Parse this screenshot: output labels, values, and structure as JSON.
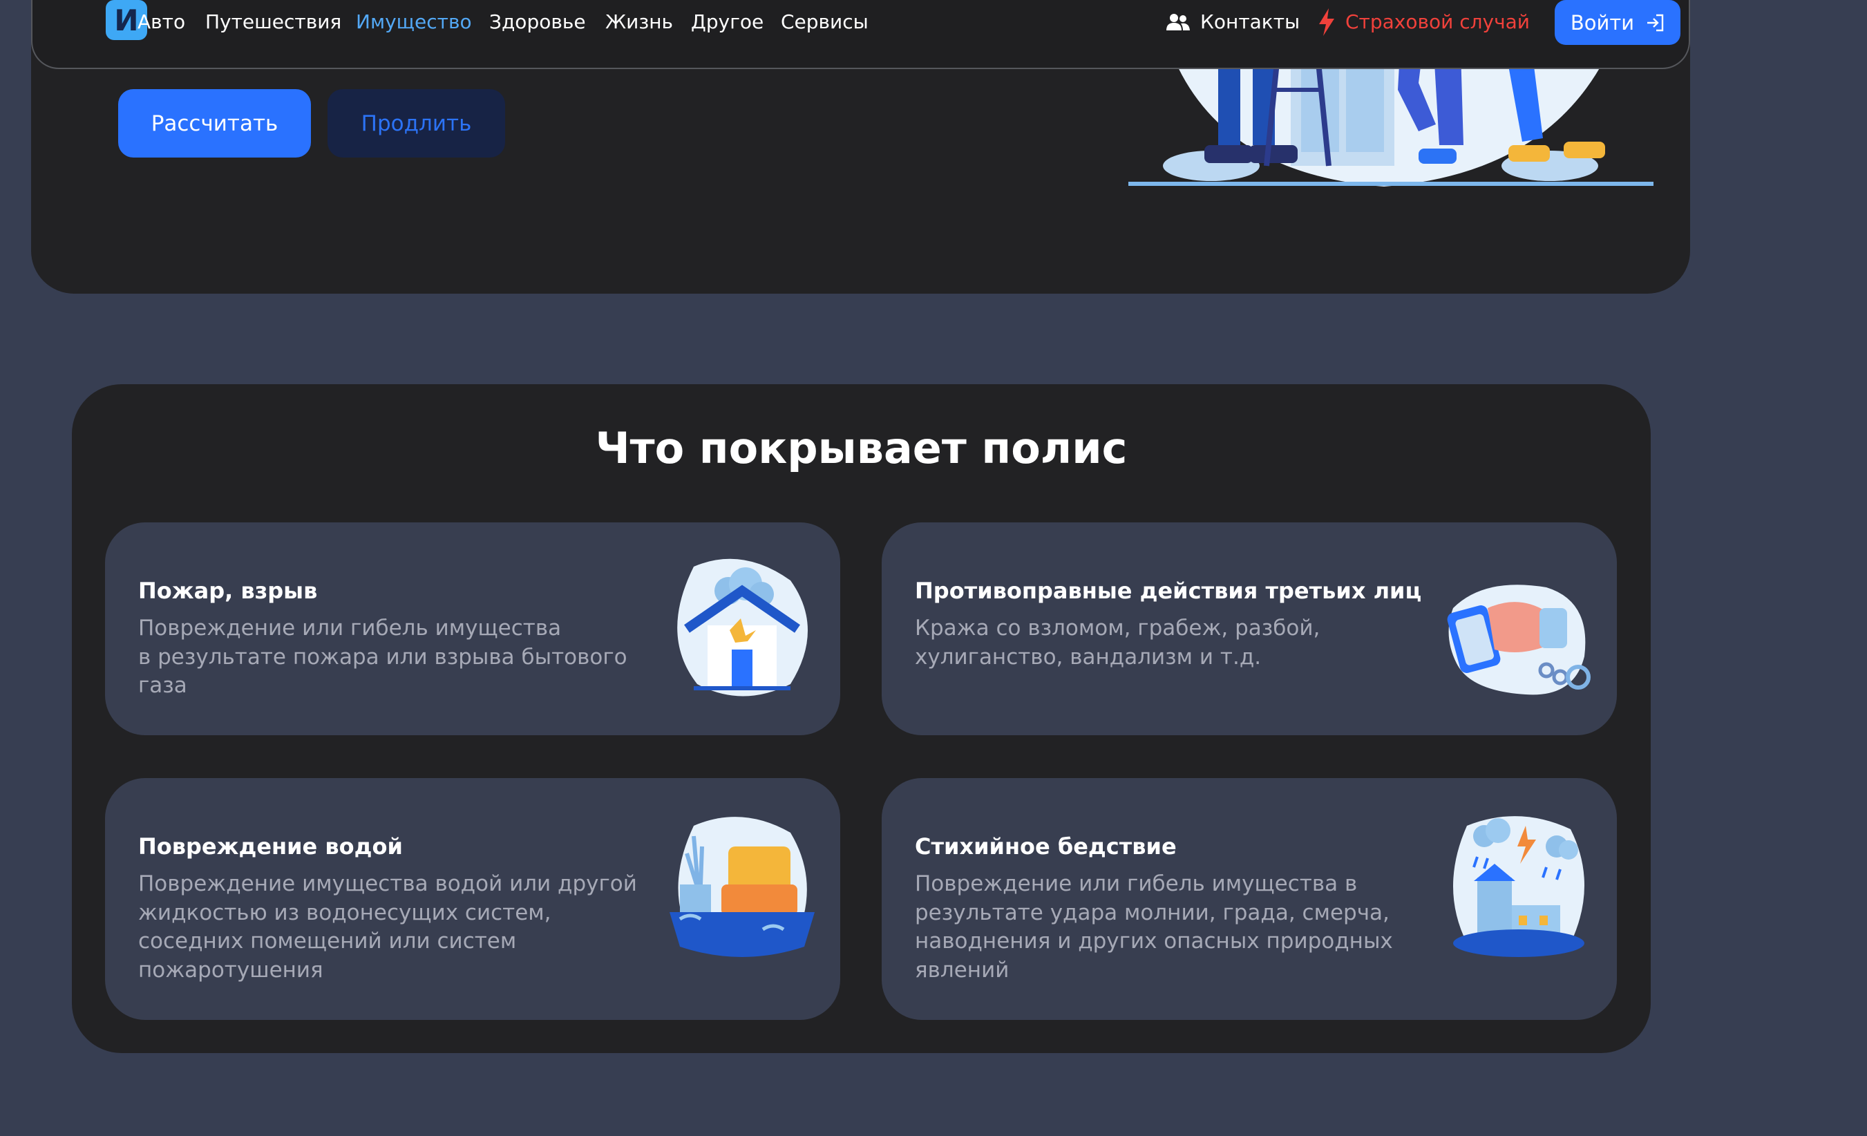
{
  "nav": {
    "logo_letter": "И",
    "links": [
      "Авто",
      "Путешествия",
      "Имущество",
      "Здоровье",
      "Жизнь",
      "Другое",
      "Сервисы"
    ],
    "active_link": "Имущество",
    "contacts_label": "Контакты",
    "claim_label": "Страховой случай",
    "login_label": "Войти"
  },
  "hero": {
    "calculate_label": "Рассчитать",
    "renew_label": "Продлить"
  },
  "coverage": {
    "title": "Что покрывает полис",
    "cards": [
      {
        "title": "Пожар, взрыв",
        "lines": [
          "Повреждение или гибель имущества",
          "в результате пожара или взрыва бытового",
          "газа"
        ],
        "icon": "house-fire-icon"
      },
      {
        "title": "Противоправные действия третьих лиц",
        "lines": [
          "Кража со взломом, грабеж, разбой,",
          "хулиганство, вандализм и т.д."
        ],
        "icon": "theft-hand-cuffs-icon"
      },
      {
        "title": "Повреждение водой",
        "lines": [
          "Повреждение имущества водой или другой",
          "жидкостью из водонесущих систем,",
          "соседних помещений или систем",
          "пожаротушения"
        ],
        "icon": "flooded-armchair-icon"
      },
      {
        "title": "Стихийное бедствие",
        "lines": [
          "Повреждение или гибель имущества в",
          "результате удара молнии, града, смерча,",
          "наводнения и других опасных природных",
          "явлений"
        ],
        "icon": "storm-house-icon"
      }
    ]
  },
  "colors": {
    "page_bg": "#373e52",
    "panel_bg": "#222224",
    "card_bg": "#383e50",
    "accent_blue": "#2a72ff",
    "active_link": "#53a8f5",
    "alert_red": "#f0413b"
  }
}
